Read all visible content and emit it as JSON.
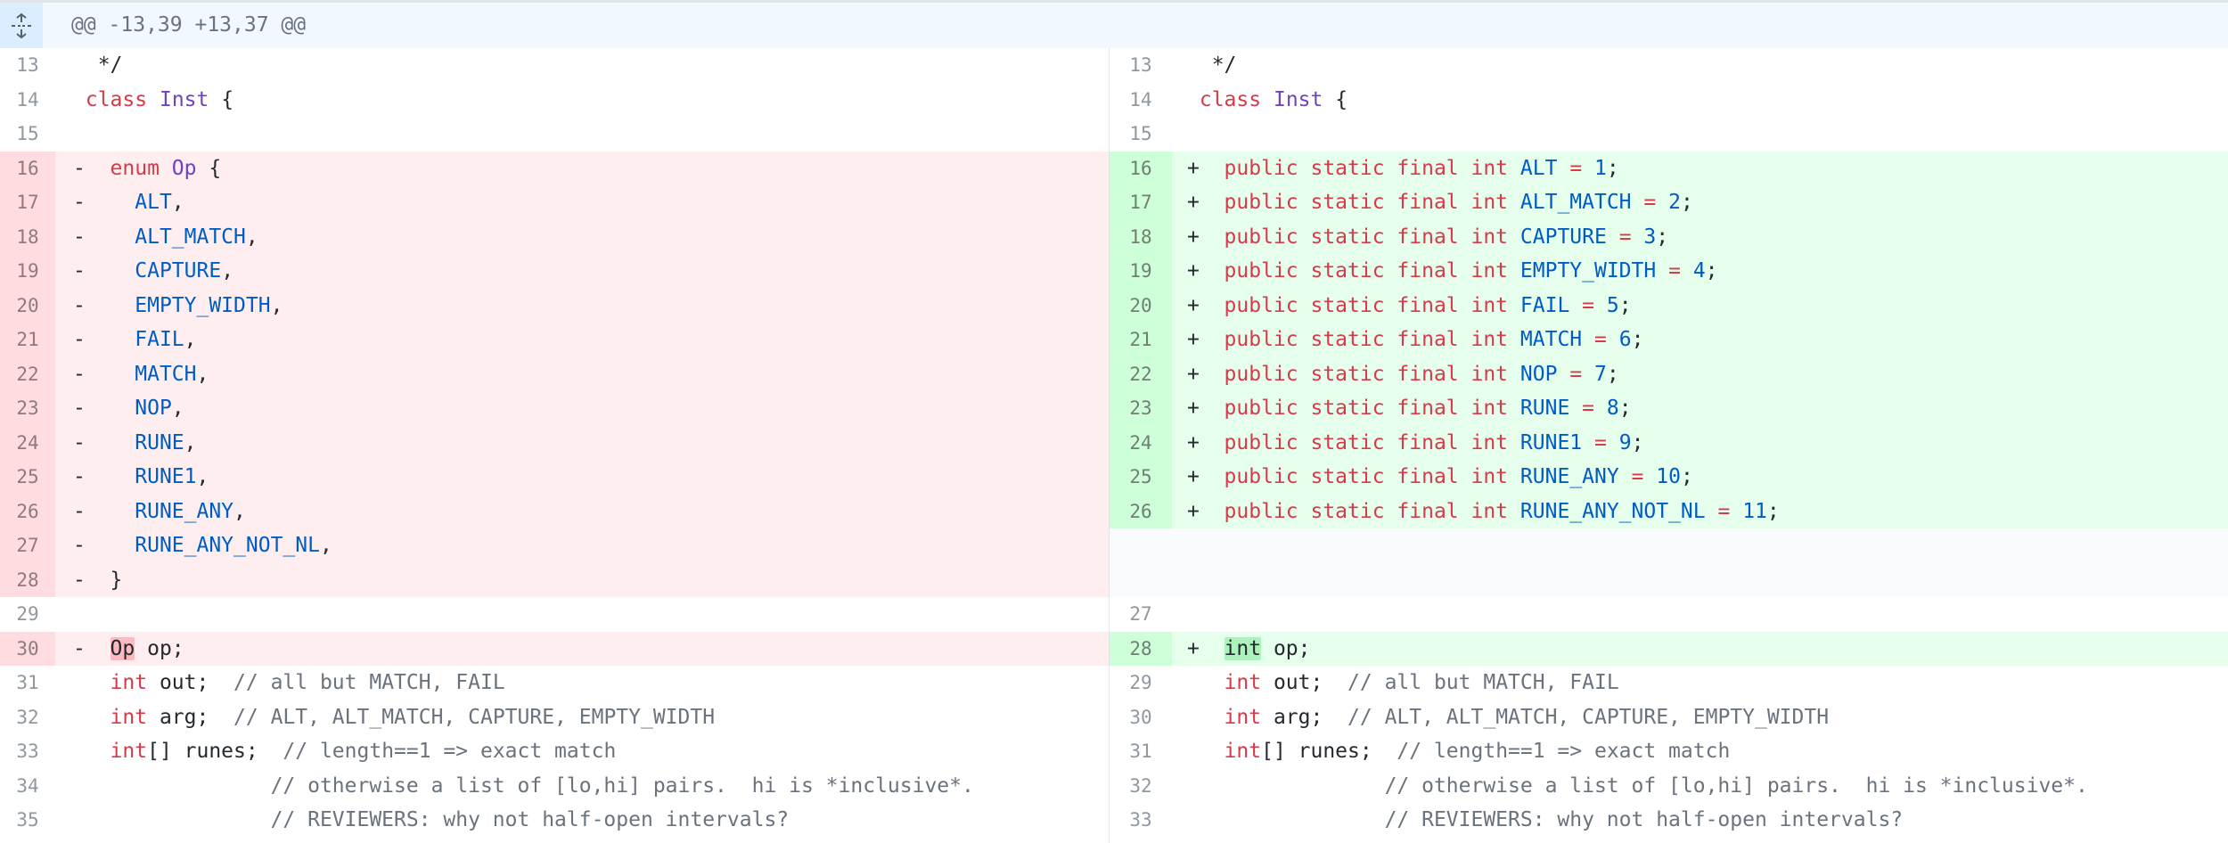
{
  "hunk": {
    "header": "@@ -13,39 +13,37 @@",
    "expand_icon": "unfold-icon"
  },
  "colors": {
    "addition_bg": "#e6ffed",
    "addition_num_bg": "#cdffd8",
    "deletion_bg": "#ffeef0",
    "deletion_num_bg": "#ffdce0",
    "keyword": "#d73a49",
    "type": "#6f42c1",
    "constant": "#005cc5",
    "comment": "#6a737d"
  },
  "left": [
    {
      "num": "13",
      "kind": "ctx",
      "tokens": [
        {
          "t": "  */",
          "c": "p"
        }
      ]
    },
    {
      "num": "14",
      "kind": "ctx",
      "tokens": [
        {
          "t": " ",
          "c": "p"
        },
        {
          "t": "class",
          "c": "k"
        },
        {
          "t": " ",
          "c": "p"
        },
        {
          "t": "Inst",
          "c": "t"
        },
        {
          "t": " {",
          "c": "p"
        }
      ]
    },
    {
      "num": "15",
      "kind": "ctx",
      "tokens": []
    },
    {
      "num": "16",
      "kind": "del",
      "tokens": [
        {
          "t": "-  ",
          "c": "p"
        },
        {
          "t": "enum",
          "c": "k"
        },
        {
          "t": " ",
          "c": "p"
        },
        {
          "t": "Op",
          "c": "t"
        },
        {
          "t": " {",
          "c": "p"
        }
      ]
    },
    {
      "num": "17",
      "kind": "del",
      "tokens": [
        {
          "t": "-    ",
          "c": "p"
        },
        {
          "t": "ALT",
          "c": "c"
        },
        {
          "t": ",",
          "c": "p"
        }
      ]
    },
    {
      "num": "18",
      "kind": "del",
      "tokens": [
        {
          "t": "-    ",
          "c": "p"
        },
        {
          "t": "ALT_MATCH",
          "c": "c"
        },
        {
          "t": ",",
          "c": "p"
        }
      ]
    },
    {
      "num": "19",
      "kind": "del",
      "tokens": [
        {
          "t": "-    ",
          "c": "p"
        },
        {
          "t": "CAPTURE",
          "c": "c"
        },
        {
          "t": ",",
          "c": "p"
        }
      ]
    },
    {
      "num": "20",
      "kind": "del",
      "tokens": [
        {
          "t": "-    ",
          "c": "p"
        },
        {
          "t": "EMPTY_WIDTH",
          "c": "c"
        },
        {
          "t": ",",
          "c": "p"
        }
      ]
    },
    {
      "num": "21",
      "kind": "del",
      "tokens": [
        {
          "t": "-    ",
          "c": "p"
        },
        {
          "t": "FAIL",
          "c": "c"
        },
        {
          "t": ",",
          "c": "p"
        }
      ]
    },
    {
      "num": "22",
      "kind": "del",
      "tokens": [
        {
          "t": "-    ",
          "c": "p"
        },
        {
          "t": "MATCH",
          "c": "c"
        },
        {
          "t": ",",
          "c": "p"
        }
      ]
    },
    {
      "num": "23",
      "kind": "del",
      "tokens": [
        {
          "t": "-    ",
          "c": "p"
        },
        {
          "t": "NOP",
          "c": "c"
        },
        {
          "t": ",",
          "c": "p"
        }
      ]
    },
    {
      "num": "24",
      "kind": "del",
      "tokens": [
        {
          "t": "-    ",
          "c": "p"
        },
        {
          "t": "RUNE",
          "c": "c"
        },
        {
          "t": ",",
          "c": "p"
        }
      ]
    },
    {
      "num": "25",
      "kind": "del",
      "tokens": [
        {
          "t": "-    ",
          "c": "p"
        },
        {
          "t": "RUNE1",
          "c": "c"
        },
        {
          "t": ",",
          "c": "p"
        }
      ]
    },
    {
      "num": "26",
      "kind": "del",
      "tokens": [
        {
          "t": "-    ",
          "c": "p"
        },
        {
          "t": "RUNE_ANY",
          "c": "c"
        },
        {
          "t": ",",
          "c": "p"
        }
      ]
    },
    {
      "num": "27",
      "kind": "del",
      "tokens": [
        {
          "t": "-    ",
          "c": "p"
        },
        {
          "t": "RUNE_ANY_NOT_NL",
          "c": "c"
        },
        {
          "t": ",",
          "c": "p"
        }
      ]
    },
    {
      "num": "28",
      "kind": "del",
      "tokens": [
        {
          "t": "-  }",
          "c": "p"
        }
      ]
    },
    {
      "num": "29",
      "kind": "ctx",
      "tokens": []
    },
    {
      "num": "30",
      "kind": "del",
      "tokens": [
        {
          "t": "-  ",
          "c": "p"
        },
        {
          "t": "Op",
          "c": "xd"
        },
        {
          "t": " op;",
          "c": "p"
        }
      ]
    },
    {
      "num": "31",
      "kind": "ctx",
      "tokens": [
        {
          "t": "   ",
          "c": "p"
        },
        {
          "t": "int",
          "c": "k"
        },
        {
          "t": " out;  ",
          "c": "p"
        },
        {
          "t": "// all but MATCH, FAIL",
          "c": "cm"
        }
      ]
    },
    {
      "num": "32",
      "kind": "ctx",
      "tokens": [
        {
          "t": "   ",
          "c": "p"
        },
        {
          "t": "int",
          "c": "k"
        },
        {
          "t": " arg;  ",
          "c": "p"
        },
        {
          "t": "// ALT, ALT_MATCH, CAPTURE, EMPTY_WIDTH",
          "c": "cm"
        }
      ]
    },
    {
      "num": "33",
      "kind": "ctx",
      "tokens": [
        {
          "t": "   ",
          "c": "p"
        },
        {
          "t": "int",
          "c": "k"
        },
        {
          "t": "[] runes;  ",
          "c": "p"
        },
        {
          "t": "// length==1 => exact match",
          "c": "cm"
        }
      ]
    },
    {
      "num": "34",
      "kind": "ctx",
      "tokens": [
        {
          "t": "                ",
          "c": "p"
        },
        {
          "t": "// otherwise a list of [lo,hi] pairs.  hi is *inclusive*.",
          "c": "cm"
        }
      ]
    },
    {
      "num": "35",
      "kind": "ctx",
      "tokens": [
        {
          "t": "                ",
          "c": "p"
        },
        {
          "t": "// REVIEWERS: why not half-open intervals?",
          "c": "cm"
        }
      ]
    }
  ],
  "right": [
    {
      "num": "13",
      "kind": "ctx",
      "tokens": [
        {
          "t": "  */",
          "c": "p"
        }
      ]
    },
    {
      "num": "14",
      "kind": "ctx",
      "tokens": [
        {
          "t": " ",
          "c": "p"
        },
        {
          "t": "class",
          "c": "k"
        },
        {
          "t": " ",
          "c": "p"
        },
        {
          "t": "Inst",
          "c": "t"
        },
        {
          "t": " {",
          "c": "p"
        }
      ]
    },
    {
      "num": "15",
      "kind": "ctx",
      "tokens": []
    },
    {
      "num": "16",
      "kind": "add",
      "tokens": [
        {
          "t": "+  ",
          "c": "p"
        },
        {
          "t": "public static final int",
          "c": "k"
        },
        {
          "t": " ",
          "c": "p"
        },
        {
          "t": "ALT",
          "c": "c"
        },
        {
          "t": " ",
          "c": "p"
        },
        {
          "t": "=",
          "c": "k"
        },
        {
          "t": " ",
          "c": "p"
        },
        {
          "t": "1",
          "c": "c"
        },
        {
          "t": ";",
          "c": "p"
        }
      ]
    },
    {
      "num": "17",
      "kind": "add",
      "tokens": [
        {
          "t": "+  ",
          "c": "p"
        },
        {
          "t": "public static final int",
          "c": "k"
        },
        {
          "t": " ",
          "c": "p"
        },
        {
          "t": "ALT_MATCH",
          "c": "c"
        },
        {
          "t": " ",
          "c": "p"
        },
        {
          "t": "=",
          "c": "k"
        },
        {
          "t": " ",
          "c": "p"
        },
        {
          "t": "2",
          "c": "c"
        },
        {
          "t": ";",
          "c": "p"
        }
      ]
    },
    {
      "num": "18",
      "kind": "add",
      "tokens": [
        {
          "t": "+  ",
          "c": "p"
        },
        {
          "t": "public static final int",
          "c": "k"
        },
        {
          "t": " ",
          "c": "p"
        },
        {
          "t": "CAPTURE",
          "c": "c"
        },
        {
          "t": " ",
          "c": "p"
        },
        {
          "t": "=",
          "c": "k"
        },
        {
          "t": " ",
          "c": "p"
        },
        {
          "t": "3",
          "c": "c"
        },
        {
          "t": ";",
          "c": "p"
        }
      ]
    },
    {
      "num": "19",
      "kind": "add",
      "tokens": [
        {
          "t": "+  ",
          "c": "p"
        },
        {
          "t": "public static final int",
          "c": "k"
        },
        {
          "t": " ",
          "c": "p"
        },
        {
          "t": "EMPTY_WIDTH",
          "c": "c"
        },
        {
          "t": " ",
          "c": "p"
        },
        {
          "t": "=",
          "c": "k"
        },
        {
          "t": " ",
          "c": "p"
        },
        {
          "t": "4",
          "c": "c"
        },
        {
          "t": ";",
          "c": "p"
        }
      ]
    },
    {
      "num": "20",
      "kind": "add",
      "tokens": [
        {
          "t": "+  ",
          "c": "p"
        },
        {
          "t": "public static final int",
          "c": "k"
        },
        {
          "t": " ",
          "c": "p"
        },
        {
          "t": "FAIL",
          "c": "c"
        },
        {
          "t": " ",
          "c": "p"
        },
        {
          "t": "=",
          "c": "k"
        },
        {
          "t": " ",
          "c": "p"
        },
        {
          "t": "5",
          "c": "c"
        },
        {
          "t": ";",
          "c": "p"
        }
      ]
    },
    {
      "num": "21",
      "kind": "add",
      "tokens": [
        {
          "t": "+  ",
          "c": "p"
        },
        {
          "t": "public static final int",
          "c": "k"
        },
        {
          "t": " ",
          "c": "p"
        },
        {
          "t": "MATCH",
          "c": "c"
        },
        {
          "t": " ",
          "c": "p"
        },
        {
          "t": "=",
          "c": "k"
        },
        {
          "t": " ",
          "c": "p"
        },
        {
          "t": "6",
          "c": "c"
        },
        {
          "t": ";",
          "c": "p"
        }
      ]
    },
    {
      "num": "22",
      "kind": "add",
      "tokens": [
        {
          "t": "+  ",
          "c": "p"
        },
        {
          "t": "public static final int",
          "c": "k"
        },
        {
          "t": " ",
          "c": "p"
        },
        {
          "t": "NOP",
          "c": "c"
        },
        {
          "t": " ",
          "c": "p"
        },
        {
          "t": "=",
          "c": "k"
        },
        {
          "t": " ",
          "c": "p"
        },
        {
          "t": "7",
          "c": "c"
        },
        {
          "t": ";",
          "c": "p"
        }
      ]
    },
    {
      "num": "23",
      "kind": "add",
      "tokens": [
        {
          "t": "+  ",
          "c": "p"
        },
        {
          "t": "public static final int",
          "c": "k"
        },
        {
          "t": " ",
          "c": "p"
        },
        {
          "t": "RUNE",
          "c": "c"
        },
        {
          "t": " ",
          "c": "p"
        },
        {
          "t": "=",
          "c": "k"
        },
        {
          "t": " ",
          "c": "p"
        },
        {
          "t": "8",
          "c": "c"
        },
        {
          "t": ";",
          "c": "p"
        }
      ]
    },
    {
      "num": "24",
      "kind": "add",
      "tokens": [
        {
          "t": "+  ",
          "c": "p"
        },
        {
          "t": "public static final int",
          "c": "k"
        },
        {
          "t": " ",
          "c": "p"
        },
        {
          "t": "RUNE1",
          "c": "c"
        },
        {
          "t": " ",
          "c": "p"
        },
        {
          "t": "=",
          "c": "k"
        },
        {
          "t": " ",
          "c": "p"
        },
        {
          "t": "9",
          "c": "c"
        },
        {
          "t": ";",
          "c": "p"
        }
      ]
    },
    {
      "num": "25",
      "kind": "add",
      "tokens": [
        {
          "t": "+  ",
          "c": "p"
        },
        {
          "t": "public static final int",
          "c": "k"
        },
        {
          "t": " ",
          "c": "p"
        },
        {
          "t": "RUNE_ANY",
          "c": "c"
        },
        {
          "t": " ",
          "c": "p"
        },
        {
          "t": "=",
          "c": "k"
        },
        {
          "t": " ",
          "c": "p"
        },
        {
          "t": "10",
          "c": "c"
        },
        {
          "t": ";",
          "c": "p"
        }
      ]
    },
    {
      "num": "26",
      "kind": "add",
      "tokens": [
        {
          "t": "+  ",
          "c": "p"
        },
        {
          "t": "public static final int",
          "c": "k"
        },
        {
          "t": " ",
          "c": "p"
        },
        {
          "t": "RUNE_ANY_NOT_NL",
          "c": "c"
        },
        {
          "t": " ",
          "c": "p"
        },
        {
          "t": "=",
          "c": "k"
        },
        {
          "t": " ",
          "c": "p"
        },
        {
          "t": "11",
          "c": "c"
        },
        {
          "t": ";",
          "c": "p"
        }
      ]
    },
    {
      "num": "",
      "kind": "empty",
      "tokens": []
    },
    {
      "num": "",
      "kind": "empty",
      "tokens": []
    },
    {
      "num": "27",
      "kind": "ctx",
      "tokens": []
    },
    {
      "num": "28",
      "kind": "add",
      "tokens": [
        {
          "t": "+  ",
          "c": "p"
        },
        {
          "t": "int",
          "c": "xa"
        },
        {
          "t": " op;",
          "c": "p"
        }
      ]
    },
    {
      "num": "29",
      "kind": "ctx",
      "tokens": [
        {
          "t": "   ",
          "c": "p"
        },
        {
          "t": "int",
          "c": "k"
        },
        {
          "t": " out;  ",
          "c": "p"
        },
        {
          "t": "// all but MATCH, FAIL",
          "c": "cm"
        }
      ]
    },
    {
      "num": "30",
      "kind": "ctx",
      "tokens": [
        {
          "t": "   ",
          "c": "p"
        },
        {
          "t": "int",
          "c": "k"
        },
        {
          "t": " arg;  ",
          "c": "p"
        },
        {
          "t": "// ALT, ALT_MATCH, CAPTURE, EMPTY_WIDTH",
          "c": "cm"
        }
      ]
    },
    {
      "num": "31",
      "kind": "ctx",
      "tokens": [
        {
          "t": "   ",
          "c": "p"
        },
        {
          "t": "int",
          "c": "k"
        },
        {
          "t": "[] runes;  ",
          "c": "p"
        },
        {
          "t": "// length==1 => exact match",
          "c": "cm"
        }
      ]
    },
    {
      "num": "32",
      "kind": "ctx",
      "tokens": [
        {
          "t": "                ",
          "c": "p"
        },
        {
          "t": "// otherwise a list of [lo,hi] pairs.  hi is *inclusive*.",
          "c": "cm"
        }
      ]
    },
    {
      "num": "33",
      "kind": "ctx",
      "tokens": [
        {
          "t": "                ",
          "c": "p"
        },
        {
          "t": "// REVIEWERS: why not half-open intervals?",
          "c": "cm"
        }
      ]
    }
  ]
}
